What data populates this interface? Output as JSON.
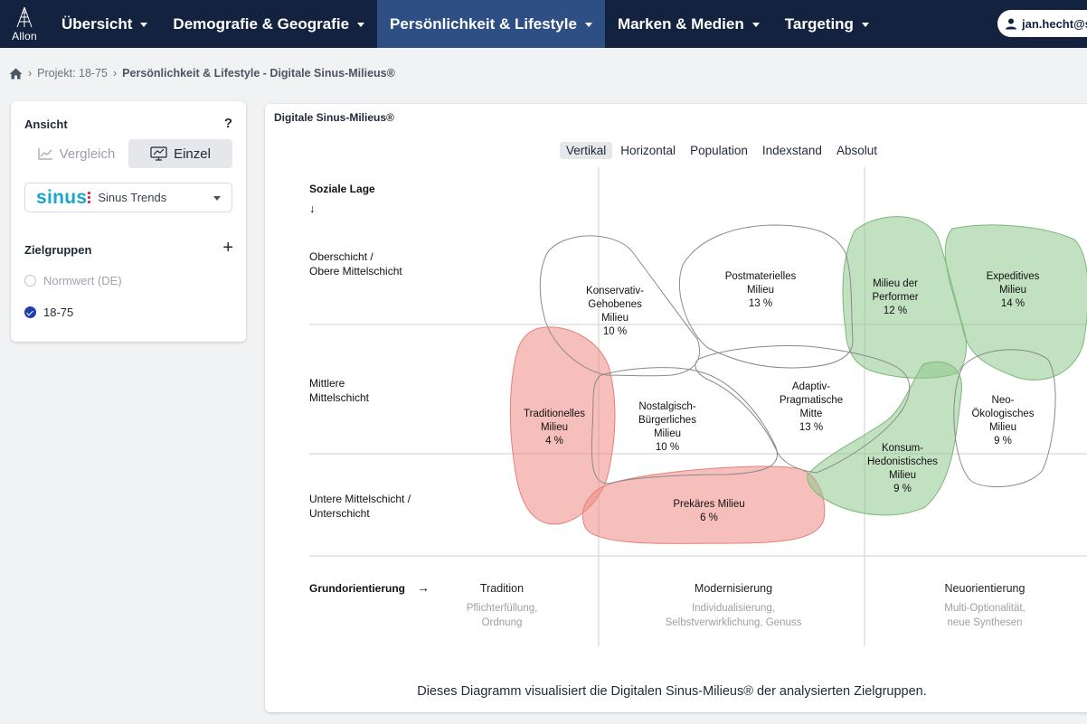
{
  "app": {
    "logo_text": "Allon"
  },
  "nav": {
    "items": [
      {
        "label": "Übersicht",
        "active": false
      },
      {
        "label": "Demografie & Geografie",
        "active": false
      },
      {
        "label": "Persönlichkeit & Lifestyle",
        "active": true
      },
      {
        "label": "Marken & Medien",
        "active": false
      },
      {
        "label": "Targeting",
        "active": false
      }
    ],
    "user": "jan.hecht@s"
  },
  "breadcrumb": {
    "project": "Projekt: 18-75",
    "current": "Persönlichkeit & Lifestyle - Digitale Sinus-Milieus®"
  },
  "panel": {
    "title": "Ansicht",
    "help": "?",
    "view_options": [
      {
        "label": "Vergleich",
        "selected": false
      },
      {
        "label": "Einzel",
        "selected": true
      }
    ],
    "source_brand": "sinus",
    "source_label": "Sinus Trends",
    "groups_title": "Zielgruppen",
    "add_symbol": "+",
    "groups": [
      {
        "label": "Normwert (DE)",
        "selected": false
      },
      {
        "label": "18-75",
        "selected": true
      }
    ]
  },
  "chart": {
    "title": "Digitale Sinus-Milieus®",
    "tabs": [
      {
        "label": "Vertikal",
        "selected": true
      },
      {
        "label": "Horizontal",
        "selected": false
      },
      {
        "label": "Population",
        "selected": false
      },
      {
        "label": "Indexstand",
        "selected": false
      },
      {
        "label": "Absolut",
        "selected": false
      }
    ],
    "caption": "Dieses Diagramm visualisiert die Digitalen Sinus-Milieus® der analysierten Zielgruppen."
  },
  "colors": {
    "nav_bg": "#12223f",
    "nav_active": "#2d4f84",
    "red_fill": "#f08b84",
    "green_fill": "#8fc98d",
    "outline": "#8a8a8a"
  },
  "chart_data": {
    "type": "diagram",
    "y_axis": {
      "title": "Soziale Lage",
      "arrow": "↓",
      "levels": [
        "Oberschicht / Obere Mittelschicht",
        "Mittlere Mittelschicht",
        "Untere Mittelschicht / Unterschicht"
      ]
    },
    "x_axis": {
      "title": "Grundorientierung",
      "arrow": "→",
      "columns": [
        {
          "name": "Tradition",
          "sub": [
            "Pflichterfüllung,",
            "Ordnung"
          ]
        },
        {
          "name": "Modernisierung",
          "sub": [
            "Individualisierung,",
            "Selbstverwirklichung, Genuss"
          ]
        },
        {
          "name": "Neuorientierung",
          "sub": [
            "Multi-Optionalität,",
            "neue Synthesen"
          ]
        }
      ]
    },
    "milieus": [
      {
        "name": [
          "Konservativ-",
          "Gehobenes",
          "Milieu"
        ],
        "value": "10 %",
        "highlight": "none"
      },
      {
        "name": [
          "Postmaterielles",
          "Milieu"
        ],
        "value": "13 %",
        "highlight": "none"
      },
      {
        "name": [
          "Milieu der",
          "Performer"
        ],
        "value": "12 %",
        "highlight": "green"
      },
      {
        "name": [
          "Expeditives",
          "Milieu"
        ],
        "value": "14 %",
        "highlight": "green"
      },
      {
        "name": [
          "Traditionelles",
          "Milieu"
        ],
        "value": "4 %",
        "highlight": "red"
      },
      {
        "name": [
          "Nostalgisch-",
          "Bürgerliches",
          "Milieu"
        ],
        "value": "10 %",
        "highlight": "none"
      },
      {
        "name": [
          "Adaptiv-",
          "Pragmatische",
          "Mitte"
        ],
        "value": "13 %",
        "highlight": "none"
      },
      {
        "name": [
          "Neo-",
          "Ökologisches",
          "Milieu"
        ],
        "value": "9 %",
        "highlight": "none"
      },
      {
        "name": [
          "Konsum-",
          "Hedonistisches",
          "Milieu"
        ],
        "value": "9 %",
        "highlight": "green"
      },
      {
        "name": [
          "Prekäres Milieu"
        ],
        "value": "6 %",
        "highlight": "red"
      }
    ]
  }
}
